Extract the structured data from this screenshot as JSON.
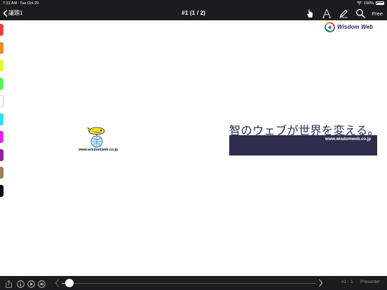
{
  "status_bar": {
    "time": "7:31 AM",
    "date": "Tue Oct 29",
    "battery": "100%"
  },
  "nav": {
    "back_label": "議題1",
    "title": "#1 (1 / 2)",
    "tools": [
      "hand-pointer-icon",
      "text-icon",
      "highlighter-icon",
      "zoom-icon"
    ],
    "free_label": "Free"
  },
  "palette": {
    "colors": [
      "#ff3b3b",
      "#ff8c1a",
      "#e6ff1a",
      "#4dff4d",
      "#ffffff",
      "#1ae6ff",
      "#ff1aff",
      "#9b1aa6",
      "#a67c52",
      "#000000"
    ]
  },
  "slide": {
    "brand_name": "Wisdom Web",
    "mascot_url": "www.wisdomweb.co.jp",
    "tagline": "智のウェブが世界を変える。",
    "banner_url": "www.wisdomweb.co.jp",
    "banner_color": "#2e2d4d",
    "tagline_color": "#2b2c52"
  },
  "bottom": {
    "controls": [
      "share-icon",
      "info-icon",
      "play-icon",
      "skip-to-end-icon"
    ],
    "slider_position": 0.02,
    "page_label": "#1 - 1",
    "presenter_label": "Presenter"
  }
}
